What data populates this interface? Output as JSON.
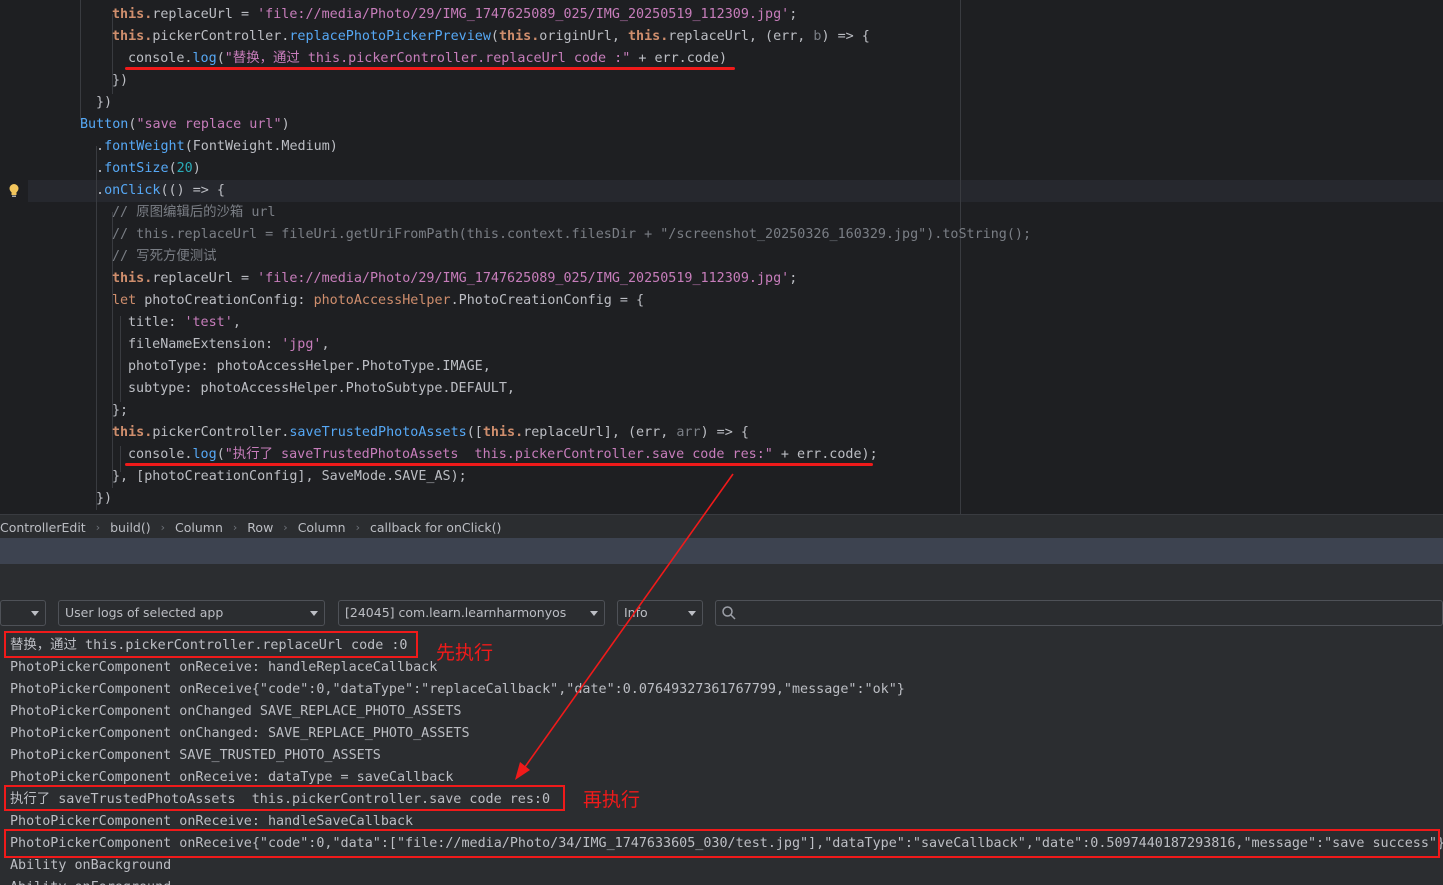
{
  "editor": {
    "lines": [
      {
        "t": [
          [
            "this.",
            "this"
          ],
          [
            "replaceUrl = ",
            "par"
          ],
          [
            "'file://media/Photo/29/IMG_1747625089_025/IMG_20250519_112309.jpg'",
            "str2"
          ],
          [
            ";",
            "par"
          ]
        ]
      },
      {
        "t": [
          [
            "this.",
            "this"
          ],
          [
            "pickerController.",
            "par"
          ],
          [
            "replacePhotoPickerPreview",
            "fn"
          ],
          [
            "(",
            "par"
          ],
          [
            "this.",
            "this"
          ],
          [
            "originUrl, ",
            "par"
          ],
          [
            "this.",
            "this"
          ],
          [
            "replaceUrl, (err, ",
            "par"
          ],
          [
            "b",
            "cm"
          ],
          [
            ") => {",
            "par"
          ]
        ]
      },
      {
        "t": [
          [
            "console.",
            "par"
          ],
          [
            "log",
            "fn"
          ],
          [
            "(",
            "par"
          ],
          [
            "\"替换，通过 this.pickerController.replaceUrl code :\"",
            "str2"
          ],
          [
            " + err.code)",
            "par"
          ]
        ]
      },
      {
        "t": [
          [
            "})",
            "par"
          ]
        ]
      },
      {
        "t": [
          [
            "})",
            "par"
          ]
        ]
      },
      {
        "t": [
          [
            "Button",
            "fn"
          ],
          [
            "(",
            "par"
          ],
          [
            "\"save replace url\"",
            "str2"
          ],
          [
            ")",
            "par"
          ]
        ]
      },
      {
        "t": [
          [
            ".",
            "par"
          ],
          [
            "fontWeight",
            "fn"
          ],
          [
            "(FontWeight.Medium)",
            "par"
          ]
        ]
      },
      {
        "t": [
          [
            ".",
            "par"
          ],
          [
            "fontSize",
            "fn"
          ],
          [
            "(",
            "par"
          ],
          [
            "20",
            "num"
          ],
          [
            ")",
            "par"
          ]
        ]
      },
      {
        "t": [
          [
            ".",
            "par"
          ],
          [
            "onClick",
            "fn"
          ],
          [
            "(() => {",
            "par"
          ]
        ]
      },
      {
        "t": [
          [
            "// 原图编辑后的沙箱 url",
            "cm"
          ]
        ]
      },
      {
        "t": [
          [
            "// this.replaceUrl = fileUri.getUriFromPath(this.context.filesDir + \"/screenshot_20250326_160329.jpg\").toString();",
            "cm"
          ]
        ]
      },
      {
        "t": [
          [
            "// 写死方便测试",
            "cm"
          ]
        ]
      },
      {
        "t": [
          [
            "this.",
            "this"
          ],
          [
            "replaceUrl = ",
            "par"
          ],
          [
            "'file://media/Photo/29/IMG_1747625089_025/IMG_20250519_112309.jpg'",
            "str2"
          ],
          [
            ";",
            "par"
          ]
        ]
      },
      {
        "t": [
          [
            "let ",
            "kw"
          ],
          [
            "photoCreationConfig: ",
            "par"
          ],
          [
            "photoAccessHelper",
            "kw"
          ],
          [
            ".PhotoCreationConfig = {",
            "par"
          ]
        ]
      },
      {
        "t": [
          [
            "title: ",
            "par"
          ],
          [
            "'test'",
            "str2"
          ],
          [
            ",",
            "par"
          ]
        ]
      },
      {
        "t": [
          [
            "fileNameExtension: ",
            "par"
          ],
          [
            "'jpg'",
            "str2"
          ],
          [
            ",",
            "par"
          ]
        ]
      },
      {
        "t": [
          [
            "photoType: photoAccessHelper.PhotoType.IMAGE,",
            "par"
          ]
        ]
      },
      {
        "t": [
          [
            "subtype: photoAccessHelper.PhotoSubtype.DEFAULT,",
            "par"
          ]
        ]
      },
      {
        "t": [
          [
            "};",
            "par"
          ]
        ]
      },
      {
        "t": [
          [
            "this.",
            "this"
          ],
          [
            "pickerController.",
            "par"
          ],
          [
            "saveTrustedPhotoAssets",
            "fn"
          ],
          [
            "([",
            "par"
          ],
          [
            "this.",
            "this"
          ],
          [
            "replaceUrl], (err, ",
            "par"
          ],
          [
            "arr",
            "cm"
          ],
          [
            ") => {",
            "par"
          ]
        ]
      },
      {
        "t": [
          [
            "console.",
            "par"
          ],
          [
            "log",
            "fn"
          ],
          [
            "(",
            "par"
          ],
          [
            "\"执行了 saveTrustedPhotoAssets  this.pickerController.save code res:\"",
            "str2"
          ],
          [
            " + err.code);",
            "par"
          ]
        ]
      },
      {
        "t": [
          [
            "}, [photoCreationConfig], SaveMode.SAVE_AS);",
            "par"
          ]
        ]
      },
      {
        "t": [
          [
            "})",
            "par"
          ]
        ]
      }
    ]
  },
  "breadcrumb": [
    "ControllerEdit",
    "build()",
    "Column",
    "Row",
    "Column",
    "callback for onClick()"
  ],
  "toolbar": {
    "device_value": "",
    "filter_value": "User logs of selected app",
    "process_value": "[24045] com.learn.learnharmonyos",
    "level_value": "Info",
    "search_placeholder": ""
  },
  "log": [
    "替换，通过 this.pickerController.replaceUrl code :0",
    "PhotoPickerComponent onReceive: handleReplaceCallback",
    "PhotoPickerComponent onReceive{\"code\":0,\"dataType\":\"replaceCallback\",\"date\":0.07649327361767799,\"message\":\"ok\"}",
    "PhotoPickerComponent onChanged SAVE_REPLACE_PHOTO_ASSETS",
    "PhotoPickerComponent onChanged: SAVE_REPLACE_PHOTO_ASSETS",
    "PhotoPickerComponent SAVE_TRUSTED_PHOTO_ASSETS",
    "PhotoPickerComponent onReceive: dataType = saveCallback",
    "执行了 saveTrustedPhotoAssets  this.pickerController.save code res:0",
    "PhotoPickerComponent onReceive: handleSaveCallback",
    "PhotoPickerComponent onReceive{\"code\":0,\"data\":[\"file://media/Photo/34/IMG_1747633605_030/test.jpg\"],\"dataType\":\"saveCallback\",\"date\":0.5097440187293816,\"message\":\"save success\"}",
    "Ability onBackground",
    "Ability onForeground"
  ],
  "annotations": {
    "first_label": "先执行",
    "second_label": "再执行",
    "color": "#f01a1a"
  }
}
